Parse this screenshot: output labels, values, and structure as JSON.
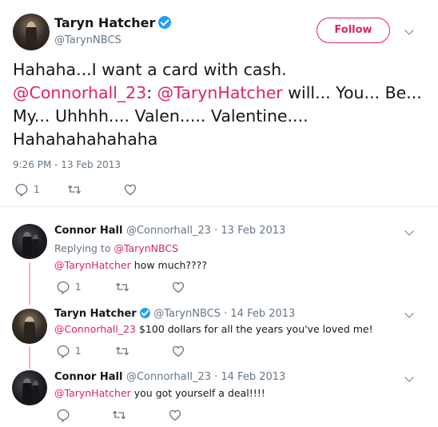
{
  "main_tweet": {
    "author_name": "Taryn Hatcher",
    "author_handle": "@TarynNBCS",
    "follow_label": "Follow",
    "text_parts": [
      "Hahaha...I want a card with cash. ",
      "@Connorhall_23",
      ": ",
      "@TarynHatcher",
      " will... You... Be... My... Uhhhh.... Valen..... Valentine.... Hahahahahahaha"
    ],
    "timestamp": "9:26 PM - 13 Feb 2013",
    "reply_count": "1"
  },
  "replies": [
    {
      "author_name": "Connor Hall",
      "meta": "@Connorhall_23 · 13 Feb 2013",
      "replying_prefix": "Replying to ",
      "replying_to": "@TarynNBCS",
      "mention": "@TarynHatcher",
      "text": " how much????",
      "reply_count": "1"
    },
    {
      "author_name": "Taryn Hatcher",
      "meta": "@TarynNBCS · 14 Feb 2013",
      "mention": "@Connorhall_23",
      "text": " $100 dollars for all the years you've loved me!",
      "reply_count": "1"
    },
    {
      "author_name": "Connor Hall",
      "meta": "@Connorhall_23 · 14 Feb 2013",
      "mention": "@TarynHatcher",
      "text": " you got yourself a deal!!!!",
      "reply_count": ""
    }
  ],
  "colors": {
    "accent": "#e0245e",
    "verified": "#1da1f2",
    "secondary_text": "#657786",
    "thread_line": "#f4b2c8"
  },
  "icons": [
    "reply-icon",
    "retweet-icon",
    "like-icon",
    "chevron-down-icon",
    "verified-badge-icon"
  ]
}
